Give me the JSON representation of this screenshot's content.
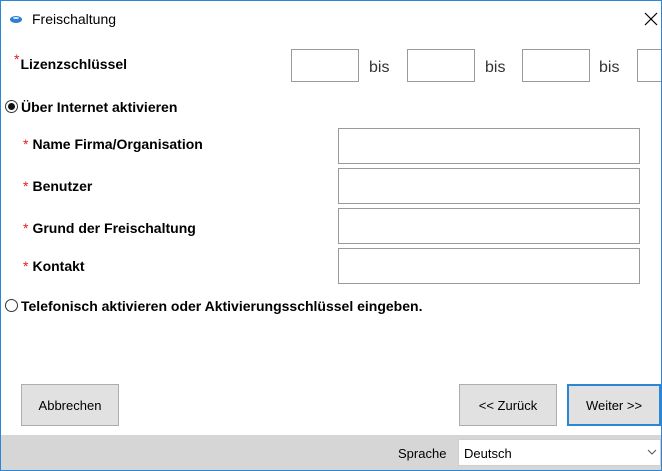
{
  "window": {
    "title": "Freischaltung"
  },
  "license": {
    "label": "Lizenzschlüssel",
    "required_mark": "*",
    "separators": [
      "bis",
      "bis",
      "bis"
    ]
  },
  "option_internet": {
    "label": "Über Internet aktivieren",
    "selected": true
  },
  "fields": [
    {
      "label": "Name Firma/Organisation",
      "value": ""
    },
    {
      "label": "Benutzer",
      "value": ""
    },
    {
      "label": "Grund der Freischaltung",
      "value": ""
    },
    {
      "label": "Kontakt",
      "value": ""
    }
  ],
  "option_phone": {
    "label": "Telefonisch aktivieren oder Aktivierungsschlüssel eingeben.",
    "selected": false
  },
  "buttons": {
    "cancel": "Abbrechen",
    "back": "<< Zurück",
    "next": "Weiter >>"
  },
  "statusbar": {
    "language_label": "Sprache",
    "language_value": "Deutsch"
  },
  "colors": {
    "accent": "#2b87d6",
    "required": "#e02020",
    "statusbar": "#d6d6d6"
  }
}
